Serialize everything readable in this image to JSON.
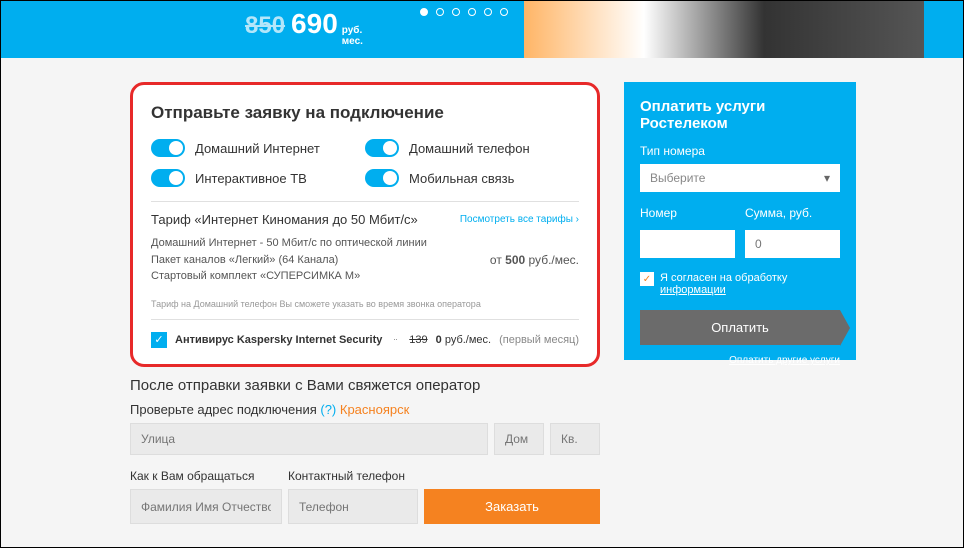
{
  "banner": {
    "old_price": "850",
    "new_price": "690",
    "unit_top": "руб.",
    "unit_bot": "мес."
  },
  "form": {
    "title": "Отправьте заявку на подключение",
    "toggles": {
      "internet": "Домашний Интернет",
      "tv": "Интерактивное ТВ",
      "phone": "Домашний телефон",
      "mobile": "Мобильная связь"
    },
    "tariff_name": "Тариф «Интернет Киномания до 50 Мбит/с»",
    "tariff_link": "Посмотреть все тарифы ›",
    "tariff_line1": "Домашний Интернет - 50 Мбит/с   по оптической линии",
    "tariff_line2": "Пакет каналов «Легкий» (64 Канала)",
    "tariff_line3": "Стартовый комплект «СУПЕРСИМКА M»",
    "tariff_price_from": "от ",
    "tariff_price_val": "500",
    "tariff_price_unit": " руб./мес.",
    "tariff_note": "Тариф на Домашний телефон Вы сможете указать во время звонка оператора",
    "av_name": "Антивирус Kaspersky Internet Security",
    "av_old": "139",
    "av_new": "0",
    "av_unit": " руб./мес.",
    "av_note": "(первый месяц)"
  },
  "below": {
    "after": "После отправки заявки с Вами свяжется оператор",
    "addr_label": "Проверьте адрес подключения ",
    "addr_q": "(?)",
    "addr_city": " Красноярск",
    "street_ph": "Улица",
    "house_ph": "Дом",
    "apt_ph": "Кв.",
    "name_label": "Как к Вам обращаться",
    "phone_label": "Контактный телефон",
    "name_ph": "Фамилия Имя Отчество",
    "phone_ph": "Телефон",
    "order": "Заказать"
  },
  "sidebar": {
    "title": "Оплатить услуги Ростелеком",
    "type_label": "Тип номера",
    "select_ph": "Выберите",
    "number_label": "Номер",
    "sum_label": "Сумма, руб.",
    "sum_ph": "0",
    "agree_text": "Я согласен на обработку ",
    "agree_link": "информации",
    "pay_btn": "Оплатить",
    "other_link": "Оплатить другие услуги"
  }
}
